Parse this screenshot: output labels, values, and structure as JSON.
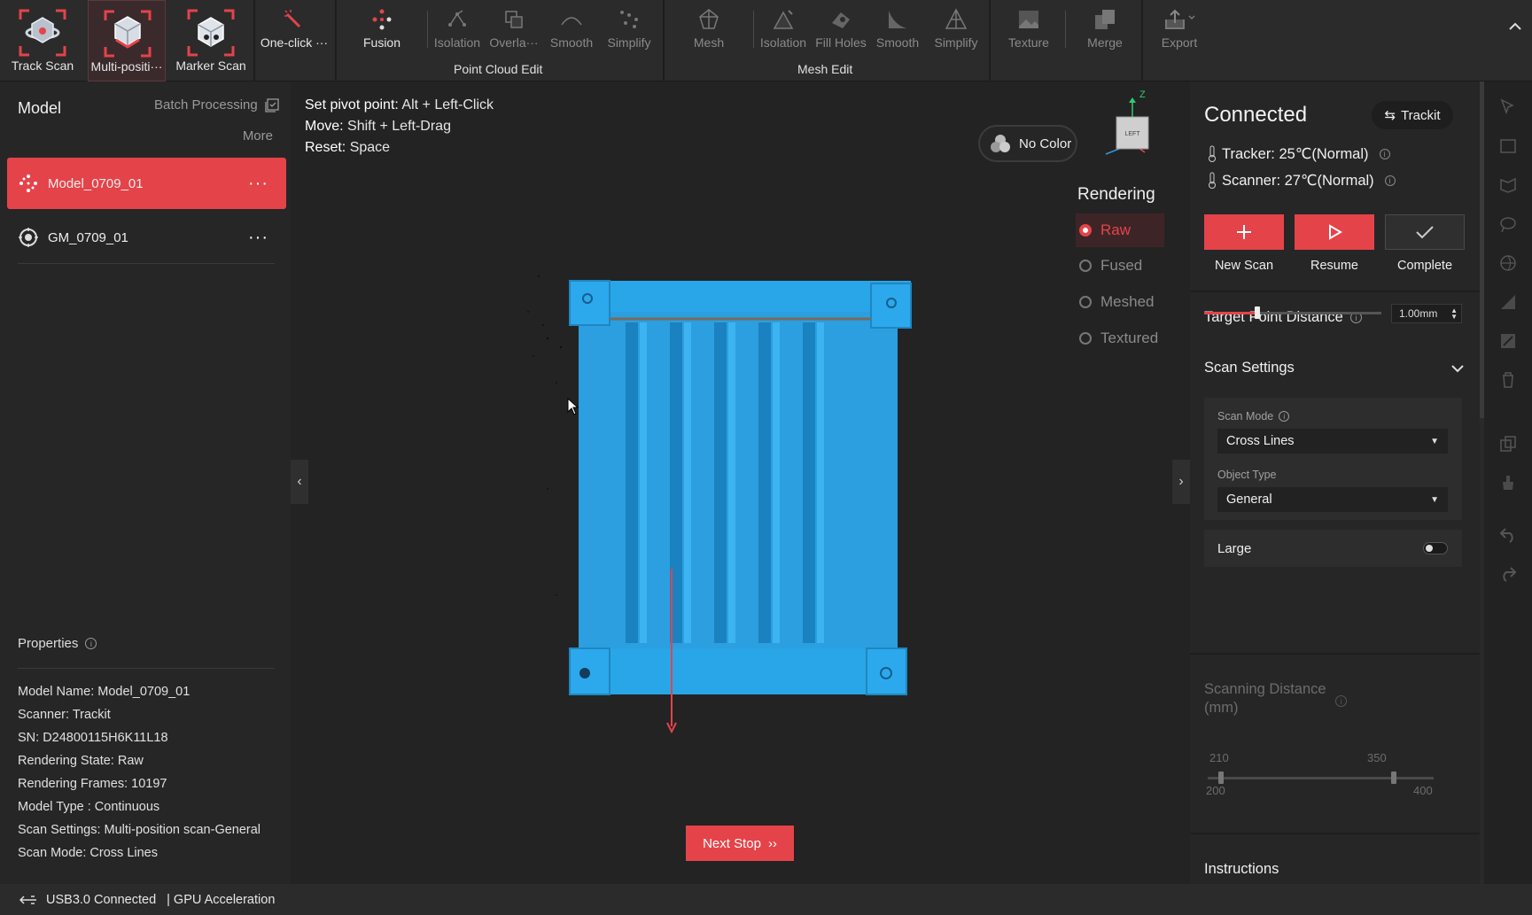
{
  "toolbar": {
    "track_scan": "Track Scan",
    "multi_position": "Multi-positi···",
    "marker_scan": "Marker Scan",
    "one_click": "One-click ···",
    "fusion": "Fusion",
    "pc_isolation": "Isolation",
    "pc_overlap": "Overla···",
    "pc_smooth": "Smooth",
    "pc_simplify": "Simplify",
    "point_cloud_edit": "Point Cloud Edit",
    "mesh": "Mesh",
    "mesh_isolation": "Isolation",
    "fill_holes": "Fill Holes",
    "mesh_smooth": "Smooth",
    "mesh_simplify": "Simplify",
    "mesh_edit": "Mesh Edit",
    "texture": "Texture",
    "merge": "Merge",
    "export": "Export",
    "collapse_icon": "chevron-up-icon"
  },
  "left_panel": {
    "title": "Model",
    "batch_processing": "Batch Processing",
    "more": "More",
    "models": [
      {
        "name": "Model_0709_01",
        "selected": true
      },
      {
        "name": "GM_0709_01",
        "selected": false
      }
    ],
    "properties_title": "Properties",
    "properties": [
      {
        "label": "Model Name:",
        "value": "Model_0709_01"
      },
      {
        "label": "Scanner:",
        "value": "Trackit"
      },
      {
        "label": "SN:",
        "value": "D24800115H6K11L18"
      },
      {
        "label": "Rendering State:",
        "value": "Raw"
      },
      {
        "label": "Rendering Frames:",
        "value": "10197"
      },
      {
        "label": "Model Type :",
        "value": "Continuous"
      },
      {
        "label": "Scan Settings:",
        "value": "Multi-position scan-General"
      },
      {
        "label": "Scan Mode:",
        "value": "Cross Lines"
      }
    ]
  },
  "viewport": {
    "hints": [
      {
        "key": "Set pivot point:",
        "val": "Alt + Left-Click"
      },
      {
        "key": "Move:",
        "val": "Shift + Left-Drag"
      },
      {
        "key": "Reset:",
        "val": "Space"
      }
    ],
    "no_color": "No Color",
    "view_cube_label": "LEFT",
    "axis_z": "Z",
    "rendering_title": "Rendering",
    "rendering_options": [
      {
        "label": "Raw",
        "active": true
      },
      {
        "label": "Fused",
        "active": false
      },
      {
        "label": "Meshed",
        "active": false
      },
      {
        "label": "Textured",
        "active": false
      }
    ],
    "next_stop": "Next Stop",
    "model_color": "#29a6e8"
  },
  "right_panel": {
    "status": "Connected",
    "device": "Trackit",
    "tracker_temp": "Tracker: 25℃(Normal)",
    "scanner_temp": "Scanner: 27℃(Normal)",
    "new_scan": "New Scan",
    "resume": "Resume",
    "complete": "Complete",
    "target_point_distance": "Target Point Distance",
    "target_point_value": "1.00mm",
    "target_point_fraction": 0.3,
    "scan_settings": "Scan Settings",
    "scan_mode_label": "Scan Mode",
    "scan_mode_value": "Cross Lines",
    "object_type_label": "Object Type",
    "object_type_value": "General",
    "large_label": "Large",
    "large_on": false,
    "scanning_distance_title_1": "Scanning Distance",
    "scanning_distance_title_2": "(mm)",
    "scan_dist_low_val": "210",
    "scan_dist_high_val": "350",
    "scan_dist_min": "200",
    "scan_dist_max": "400",
    "instructions": "Instructions"
  },
  "statusbar": {
    "usb": "USB3.0 Connected",
    "gpu": "| GPU Acceleration"
  },
  "colors": {
    "accent": "#e5434a",
    "bg": "#1e1e1e"
  }
}
